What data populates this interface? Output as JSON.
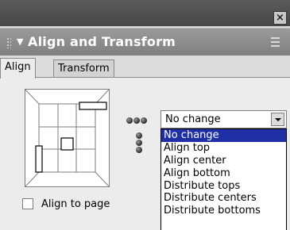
{
  "window": {
    "close_label": "×"
  },
  "panel": {
    "title": "Align and Transform"
  },
  "tabs": [
    {
      "label": "Align",
      "active": true
    },
    {
      "label": "Transform",
      "active": false
    }
  ],
  "align": {
    "select_value": "No change",
    "options": [
      "No change",
      "Align top",
      "Align center",
      "Align bottom",
      "Distribute tops",
      "Distribute centers",
      "Distribute bottoms"
    ],
    "selected_index": 0,
    "align_to_page_label": "Align to page",
    "align_to_page_checked": false
  },
  "colors": {
    "selection": "#1f2fa6",
    "header": "#8c8c8c"
  }
}
